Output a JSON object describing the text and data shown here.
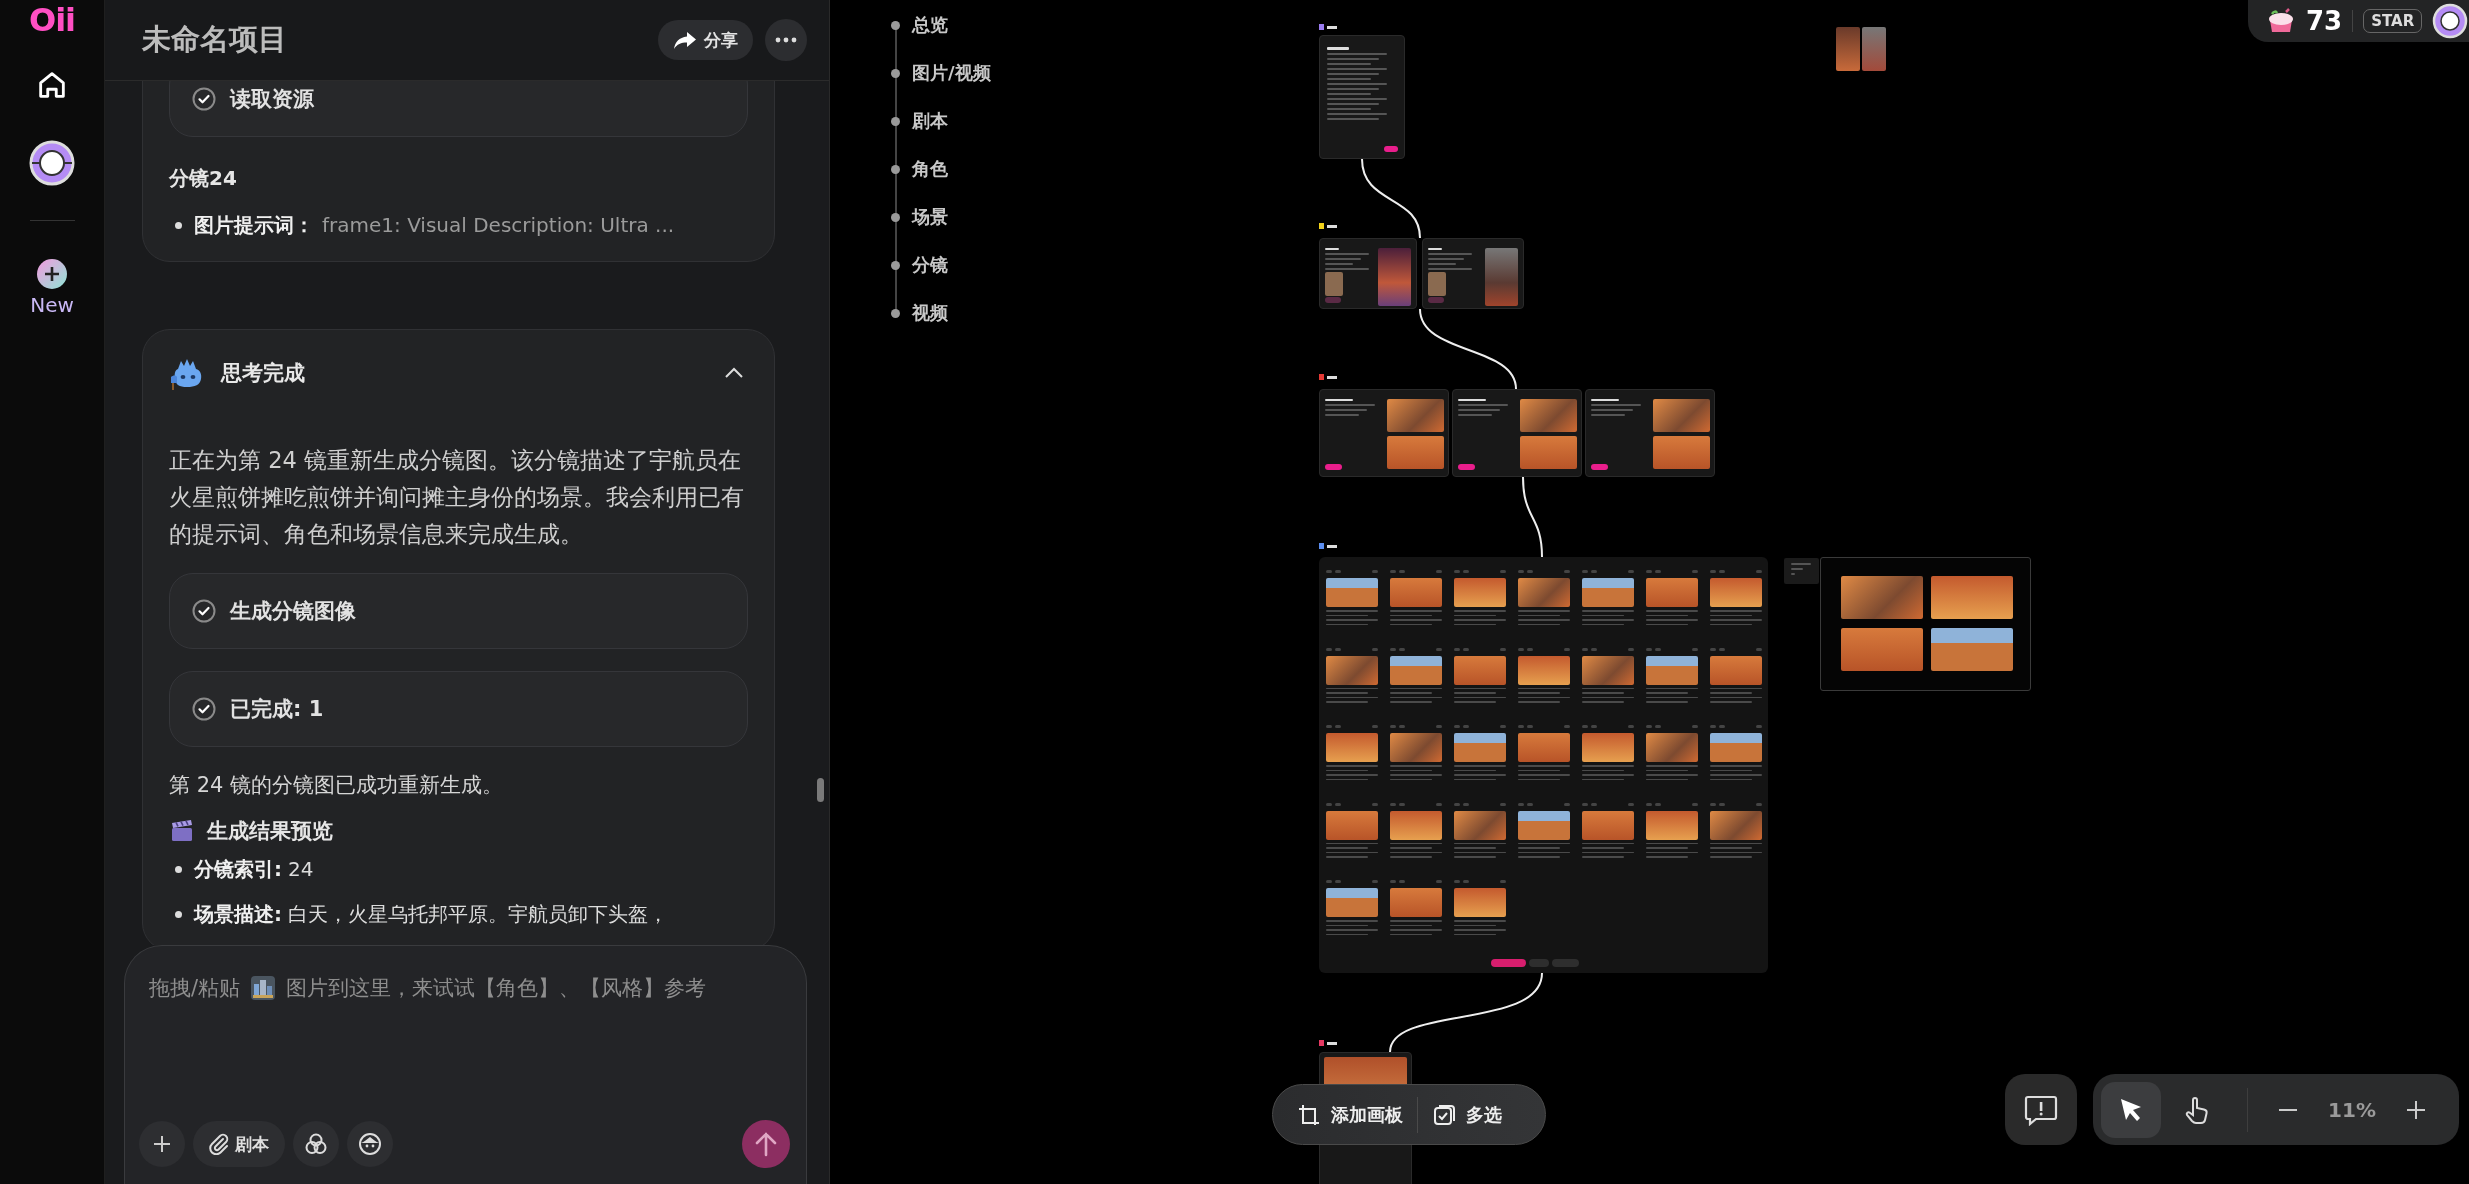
{
  "rail": {
    "logo": "Oii",
    "new_label": "New"
  },
  "chat": {
    "title": "未命名项目",
    "share_label": "分享",
    "messages": [
      {
        "kind": "result",
        "steps": [
          {
            "label": "读取资源",
            "done": true
          }
        ],
        "heading": "分镜24",
        "bullets": [
          {
            "term": "图片提示词：",
            "text": "frame1: Visual Description: Ultra ..."
          }
        ]
      },
      {
        "kind": "thinking",
        "title": "思考完成",
        "expanded": true,
        "paragraph": "正在为第 24 镜重新生成分镜图。该分镜描述了宇航员在火星煎饼摊吃煎饼并询问摊主身份的场景。我会利用已有的提示词、角色和场景信息来完成生成。",
        "steps": [
          {
            "label": "生成分镜图像",
            "done": true
          },
          {
            "label": "已完成: 1",
            "done": true
          }
        ],
        "summary": "第 24 镜的分镜图已成功重新生成。",
        "section_title": "生成结果预览",
        "bullets": [
          {
            "term": "分镜索引:",
            "text": "24"
          },
          {
            "term": "场景描述:",
            "text": "白天，火星乌托邦平原。宇航员卸下头盔，"
          }
        ]
      }
    ],
    "composer": {
      "placeholder_start": "拖拽/粘贴",
      "placeholder_end": "图片到这里，来试试【角色】、【风格】参考",
      "script_label": "剧本"
    }
  },
  "canvas": {
    "nav": [
      {
        "label": "总览"
      },
      {
        "label": "图片/视频"
      },
      {
        "label": "剧本"
      },
      {
        "label": "角色"
      },
      {
        "label": "场景"
      },
      {
        "label": "分镜"
      },
      {
        "label": "视频"
      }
    ],
    "add_board_label": "添加画板",
    "multi_select_label": "多选",
    "tools": [
      {
        "kind": "pointer",
        "selected": true
      },
      {
        "kind": "hand",
        "selected": false
      }
    ],
    "zoom_level": "11%",
    "credits": "73",
    "badge": "STAR"
  }
}
